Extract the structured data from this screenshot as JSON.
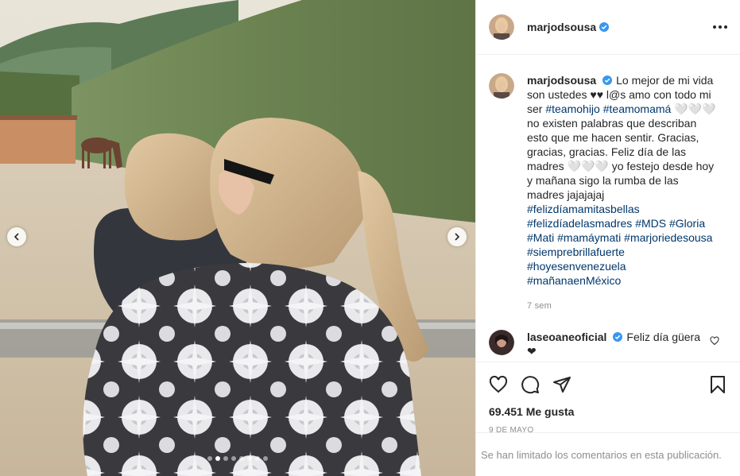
{
  "post": {
    "author": {
      "username": "marjodsousa",
      "verified": true
    },
    "media": {
      "slide_count": 8,
      "active_slide": 2
    },
    "caption": {
      "username": "marjodsousa",
      "text_1": "Lo mejor de mi vida son ustedes ♥♥ l@s amo con todo mi ser ",
      "tag_1": "#teamohijo",
      "tag_2": "#teamomamá",
      "text_2": " 🤍🤍🤍 no existen palabras que describan esto que me hacen sentir. Gracias, gracias, gracias. Feliz día de las madres 🤍🤍🤍 yo festejo desde hoy y mañana sigo la rumba de las madres jajajajaj ",
      "tags_rest": [
        "#felizdíamamitasbellas",
        "#felizdíadelasmadres",
        "#MDS",
        "#Gloria",
        "#Mati",
        "#mamáymati",
        "#marjoriedesousa",
        "#siemprebrillafuerte",
        "#hoyesenvenezuela",
        "#mañanaenMéxico"
      ],
      "time": "7 sem"
    },
    "comments": [
      {
        "username": "laseoaneoficial",
        "verified": true,
        "text": "Feliz día güera ❤"
      }
    ],
    "likes": "69.451 Me gusta",
    "date": "9 DE MAYO",
    "comments_limited": "Se han limitado los comentarios en esta publicación."
  },
  "icons": {
    "more": "more-options-icon",
    "like": "heart-icon",
    "comment": "comment-icon",
    "share": "paper-plane-icon",
    "save": "bookmark-icon",
    "verified": "verified-badge-icon"
  },
  "colors": {
    "verified": "#3897f0",
    "hashtag": "#00376b",
    "muted": "#8e8e8e",
    "border": "#efefef"
  }
}
